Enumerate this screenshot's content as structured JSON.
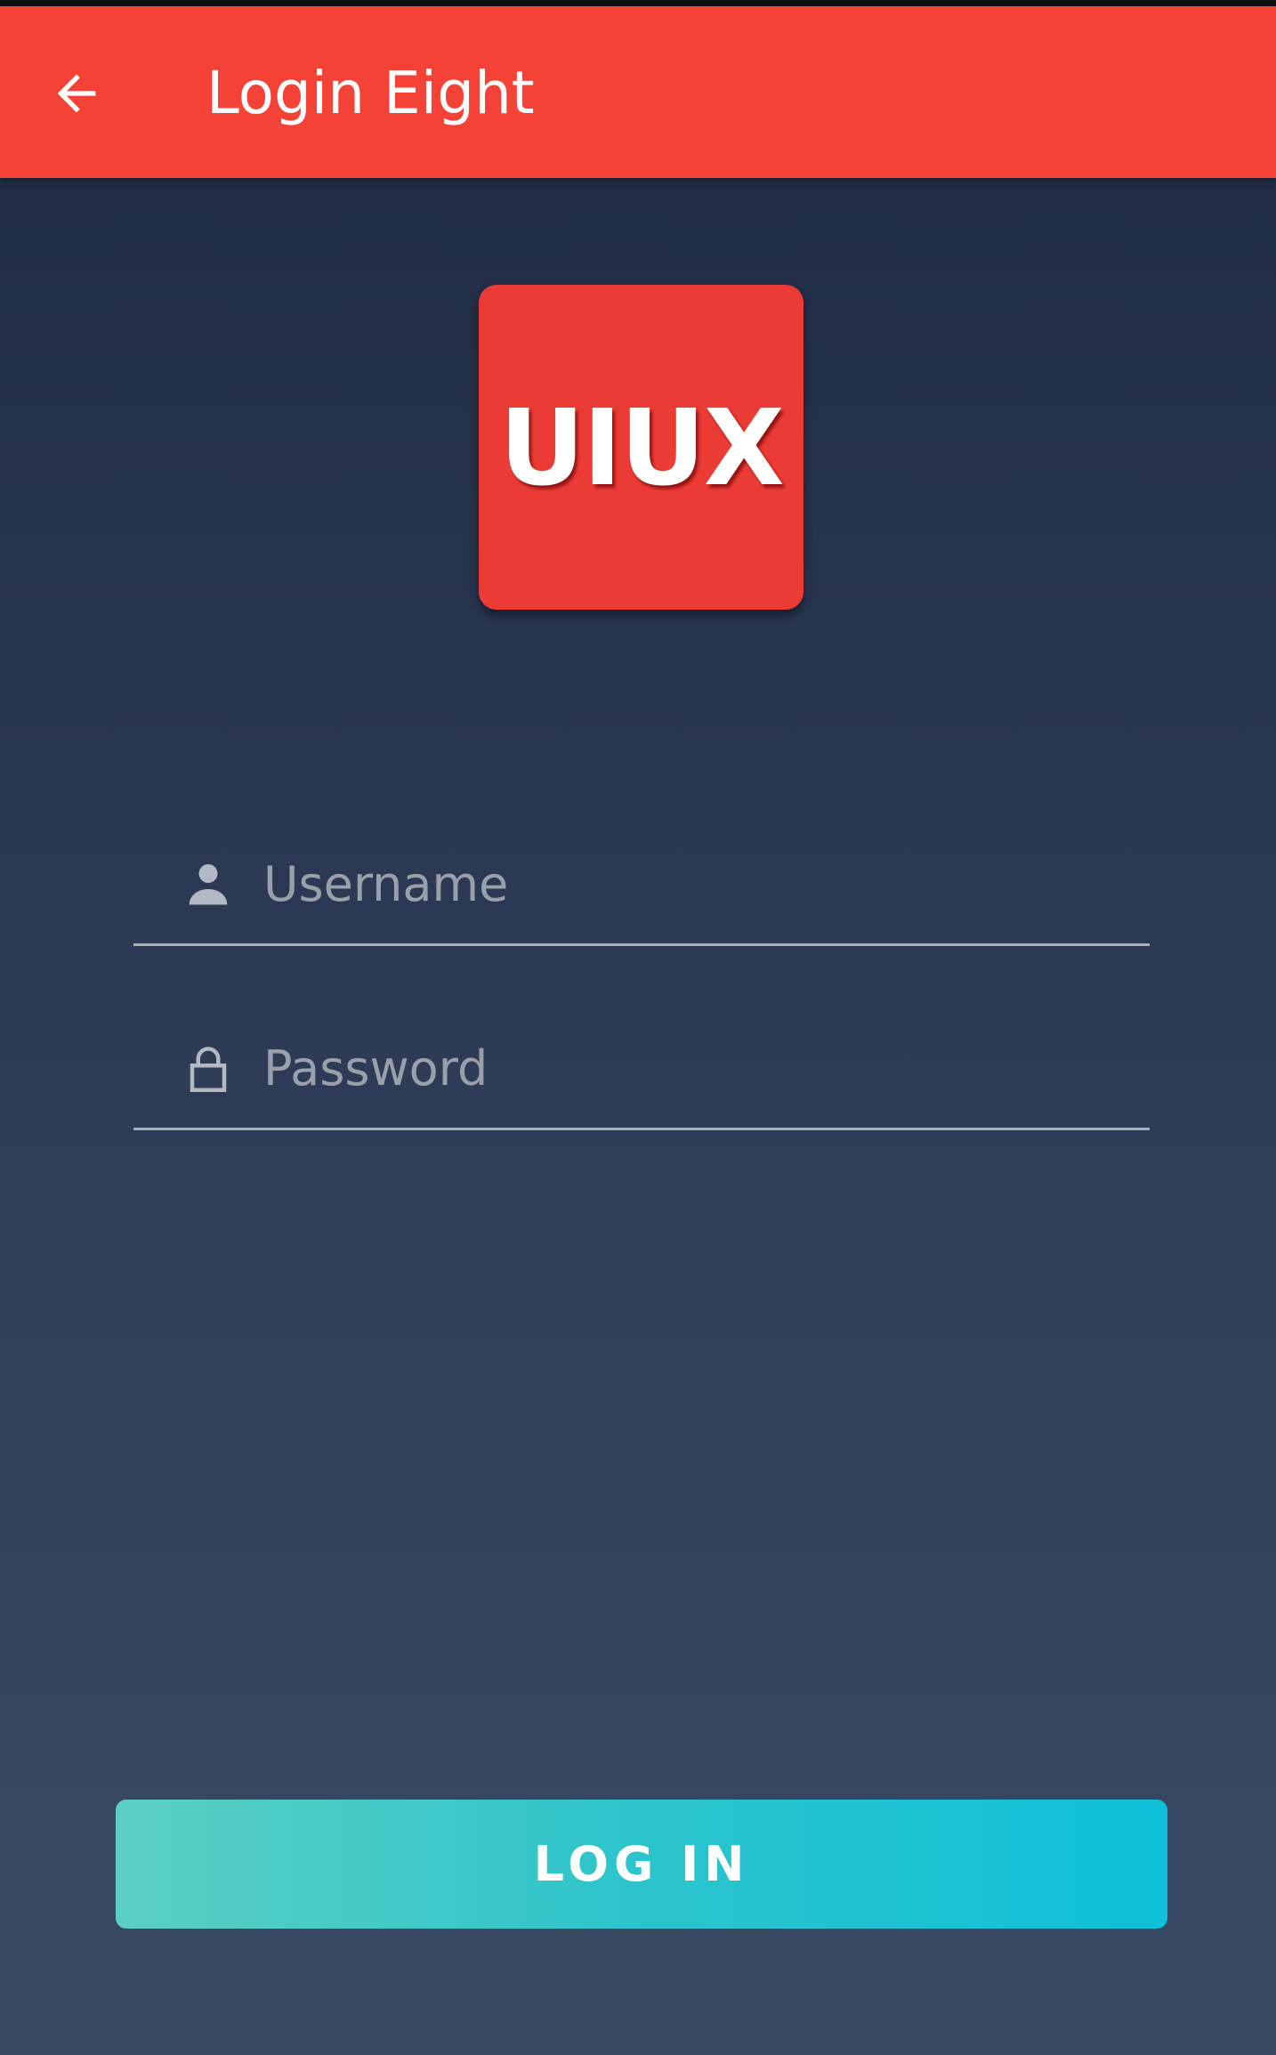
{
  "app_bar": {
    "title": "Login Eight",
    "back_icon": "arrow-back-icon",
    "color": "#f44336"
  },
  "logo": {
    "text": "UIUX",
    "color": "#ea3b34"
  },
  "form": {
    "username": {
      "placeholder": "Username",
      "value": "",
      "icon": "person-icon"
    },
    "password": {
      "placeholder": "Password",
      "value": "",
      "icon": "lock-icon"
    }
  },
  "login_button": {
    "label": "LOG IN",
    "gradient_start": "#5ccfc3",
    "gradient_end": "#0ec0d8"
  },
  "background": {
    "top": "#1f2b43",
    "bottom": "#3a4a65"
  }
}
